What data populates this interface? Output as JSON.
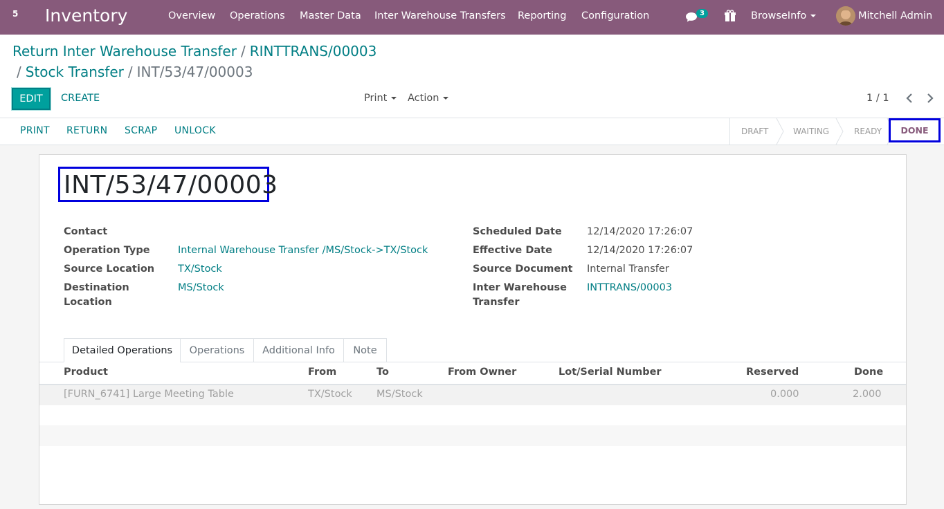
{
  "navbar": {
    "apps_label": "5",
    "brand": "Inventory",
    "menu": [
      "Overview",
      "Operations",
      "Master Data",
      "Inter Warehouse Transfers",
      "Reporting",
      "Configuration"
    ],
    "chat_count": "3",
    "company": "BrowseInfo",
    "user": "Mitchell Admin"
  },
  "breadcrumb": {
    "item1": "Return Inter Warehouse Transfer",
    "item2": "RINTTRANS/00003",
    "item3": "Stock Transfer",
    "current": "INT/53/47/00003",
    "separator": "/"
  },
  "toolbar": {
    "edit_label": "EDIT",
    "create_label": "CREATE",
    "print_label": "Print",
    "action_label": "Action",
    "pager": "1 / 1"
  },
  "statusbar": {
    "buttons": [
      "PRINT",
      "RETURN",
      "SCRAP",
      "UNLOCK"
    ],
    "stages": [
      "DRAFT",
      "WAITING",
      "READY"
    ],
    "current_stage": "DONE"
  },
  "record": {
    "name": "INT/53/47/00003",
    "left_fields": [
      {
        "label": "Contact",
        "value": ""
      },
      {
        "label": "Operation Type",
        "value": "Internal Warehouse Transfer /MS/Stock->TX/Stock"
      },
      {
        "label": "Source Location",
        "value": "TX/Stock"
      },
      {
        "label": "Destination Location",
        "value": "MS/Stock"
      }
    ],
    "right_fields": [
      {
        "label": "Scheduled Date",
        "value": "12/14/2020 17:26:07"
      },
      {
        "label": "Effective Date",
        "value": "12/14/2020 17:26:07"
      },
      {
        "label": "Source Document",
        "value": "Internal Transfer"
      },
      {
        "label": "Inter Warehouse Transfer",
        "value": "INTTRANS/00003"
      }
    ]
  },
  "tabs": [
    "Detailed Operations",
    "Operations",
    "Additional Info",
    "Note"
  ],
  "table": {
    "columns": [
      "Product",
      "From",
      "To",
      "From Owner",
      "Lot/Serial Number",
      "Reserved",
      "Done"
    ],
    "rows": [
      {
        "product": "[FURN_6741] Large Meeting Table",
        "from": "TX/Stock",
        "to": "MS/Stock",
        "from_owner": "",
        "lot": "",
        "reserved": "0.000",
        "done": "2.000"
      }
    ]
  },
  "colors": {
    "navbar": "#875a7b",
    "accent": "#00a09d",
    "link": "#017e84",
    "highlight": "#0000dd"
  }
}
